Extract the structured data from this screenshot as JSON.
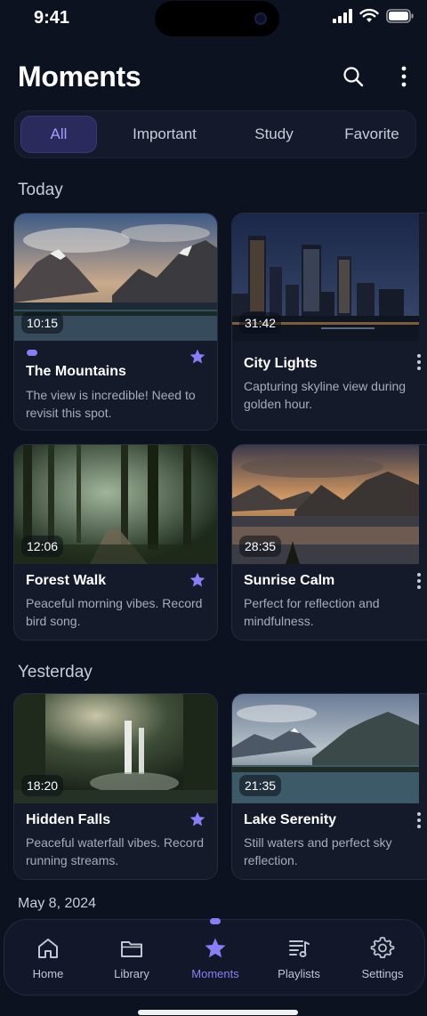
{
  "status": {
    "time": "9:41"
  },
  "header": {
    "title": "Moments",
    "search_icon": "search-icon",
    "more_icon": "more-vertical-icon"
  },
  "tabs": [
    {
      "label": "All",
      "active": true
    },
    {
      "label": "Important",
      "active": false
    },
    {
      "label": "Study",
      "active": false
    },
    {
      "label": "Favorite",
      "active": false
    }
  ],
  "sections": [
    {
      "title": "Today"
    },
    {
      "title": "Yesterday"
    },
    {
      "title": "May 8, 2024"
    }
  ],
  "cards": [
    {
      "duration": "10:15",
      "title": "The Mountains",
      "description": "The view is incredible! Need to revisit this spot.",
      "starred": true,
      "tagged": true
    },
    {
      "duration": "31:42",
      "title": "City Lights",
      "description": "Capturing skyline view during golden hour.",
      "starred": false,
      "tagged": false
    },
    {
      "duration": "12:06",
      "title": "Forest Walk",
      "description": "Peaceful morning vibes. Record bird song.",
      "starred": true,
      "tagged": false
    },
    {
      "duration": "28:35",
      "title": "Sunrise Calm",
      "description": "Perfect for reflection and mindfulness.",
      "starred": false,
      "tagged": false
    },
    {
      "duration": "18:20",
      "title": "Hidden Falls",
      "description": "Peaceful waterfall vibes. Record running streams.",
      "starred": true,
      "tagged": false
    },
    {
      "duration": "21:35",
      "title": "Lake Serenity",
      "description": "Still waters and perfect sky reflection.",
      "starred": false,
      "tagged": false
    }
  ],
  "nav": [
    {
      "label": "Home",
      "icon": "home-icon",
      "active": false
    },
    {
      "label": "Library",
      "icon": "folder-icon",
      "active": false
    },
    {
      "label": "Moments",
      "icon": "star-icon",
      "active": true
    },
    {
      "label": "Playlists",
      "icon": "playlist-icon",
      "active": false
    },
    {
      "label": "Settings",
      "icon": "gear-icon",
      "active": false
    }
  ],
  "colors": {
    "accent": "#8a7df5",
    "background": "#0d1220",
    "card": "#141a2a",
    "tab_active_bg": "#2a2a5c"
  }
}
